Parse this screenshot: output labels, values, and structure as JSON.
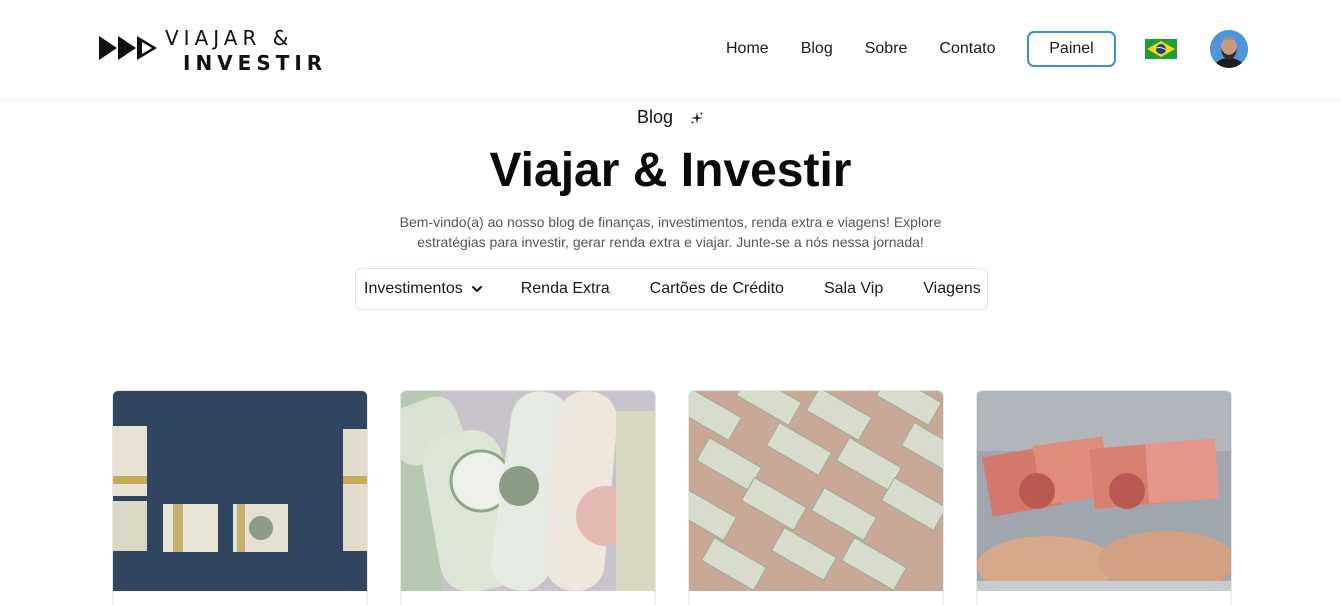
{
  "header": {
    "logo_line1": "VIAJAR &",
    "logo_line2": "INVESTIR",
    "nav": [
      "Home",
      "Blog",
      "Sobre",
      "Contato"
    ],
    "painel_label": "Painel",
    "language_flag": "brazil-flag",
    "avatar": "user-avatar"
  },
  "hero": {
    "eyebrow": "Blog",
    "title": "Viajar & Investir",
    "subtitle": "Bem-vindo(a) ao nosso blog de finanças, investimentos, renda extra e viagens! Explore estratégias para investir, gerar renda extra e viajar. Junte-se a nós nessa jornada!"
  },
  "categories": [
    "Investimentos",
    "Renda Extra",
    "Cartões de Crédito",
    "Sala Vip",
    "Viagens"
  ],
  "cards": [
    {
      "image": "money-stacks-blue-background"
    },
    {
      "image": "rolled-banknotes"
    },
    {
      "image": "hundred-dollar-bills-pattern"
    },
    {
      "image": "hands-holding-banknotes"
    }
  ],
  "colors": {
    "accent": "#3a8fd6",
    "category_border": "#cfeeee",
    "text": "#111111",
    "muted": "#555555"
  }
}
